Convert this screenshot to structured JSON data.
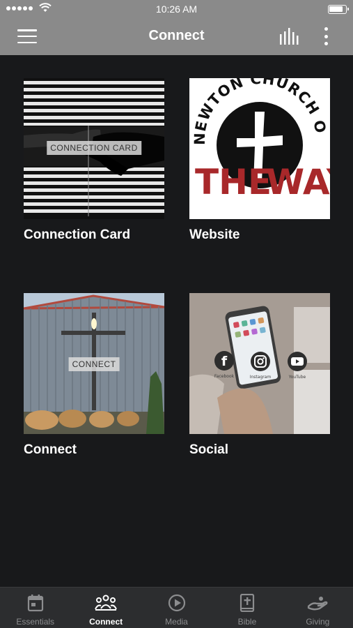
{
  "status_bar": {
    "time": "10:26 AM"
  },
  "header": {
    "title": "Connect"
  },
  "tiles": [
    {
      "label": "Connection Card",
      "overlay": "CONNECTION CARD"
    },
    {
      "label": "Website",
      "logo_line1": "NEWTON CHURCH OF",
      "logo_line2": "THE",
      "logo_line3": "WAY"
    },
    {
      "label": "Connect",
      "overlay": "CONNECT"
    },
    {
      "label": "Social",
      "icons": [
        "Facebook",
        "Instagram",
        "YouTube"
      ]
    }
  ],
  "tabs": [
    {
      "label": "Essentials",
      "icon": "calendar-icon",
      "active": false
    },
    {
      "label": "Connect",
      "icon": "people-icon",
      "active": true
    },
    {
      "label": "Media",
      "icon": "play-icon",
      "active": false
    },
    {
      "label": "Bible",
      "icon": "bible-icon",
      "active": false
    },
    {
      "label": "Giving",
      "icon": "giving-hand-icon",
      "active": false
    }
  ],
  "colors": {
    "bar_gray": "#8a8a8a",
    "background": "#18191b",
    "tabbar": "#2c2d2f",
    "logo_red": "#a8282a"
  }
}
